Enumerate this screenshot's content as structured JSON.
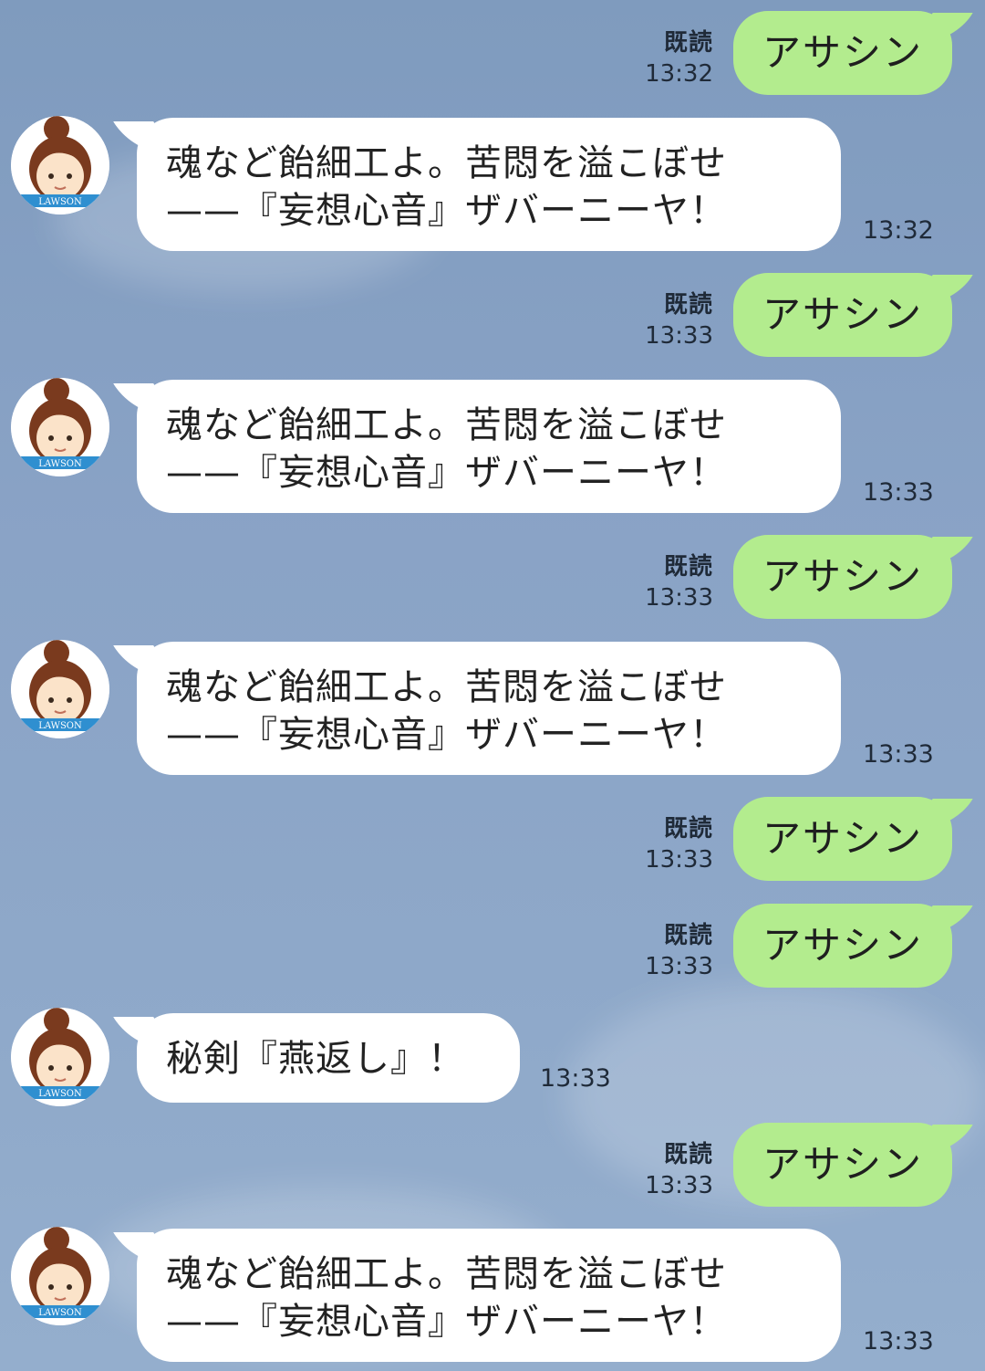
{
  "messages": [
    {
      "type": "out",
      "read": "既読",
      "time": "13:32",
      "text": "アサシン"
    },
    {
      "type": "in",
      "line1": "魂など飴細工よ。苦悶を溢こぼせ",
      "line2": "——『妄想心音』ザバーニーヤ！",
      "time": "13:32"
    },
    {
      "type": "out",
      "read": "既読",
      "time": "13:33",
      "text": "アサシン"
    },
    {
      "type": "in",
      "line1": "魂など飴細工よ。苦悶を溢こぼせ",
      "line2": "——『妄想心音』ザバーニーヤ！",
      "time": "13:33"
    },
    {
      "type": "out",
      "read": "既読",
      "time": "13:33",
      "text": "アサシン"
    },
    {
      "type": "in",
      "line1": "魂など飴細工よ。苦悶を溢こぼせ",
      "line2": "——『妄想心音』ザバーニーヤ！",
      "time": "13:33"
    },
    {
      "type": "out",
      "read": "既読",
      "time": "13:33",
      "text": "アサシン"
    },
    {
      "type": "out",
      "read": "既読",
      "time": "13:33",
      "text": "アサシン"
    },
    {
      "type": "in",
      "line1": "秘剣『燕返し』！",
      "time": "13:33"
    },
    {
      "type": "out",
      "read": "既読",
      "time": "13:33",
      "text": "アサシン"
    },
    {
      "type": "in",
      "line1": "魂など飴細工よ。苦悶を溢こぼせ",
      "line2": "——『妄想心音』ザバーニーヤ！",
      "time": "13:33"
    }
  ],
  "avatar": {
    "label": "LAWSON",
    "band_color": "#2f8fd0",
    "hair_color": "#7a3a1e",
    "skin_color": "#fbe3c9"
  },
  "colors": {
    "outgoing_bubble": "#b3ec8e",
    "incoming_bubble": "#ffffff"
  }
}
